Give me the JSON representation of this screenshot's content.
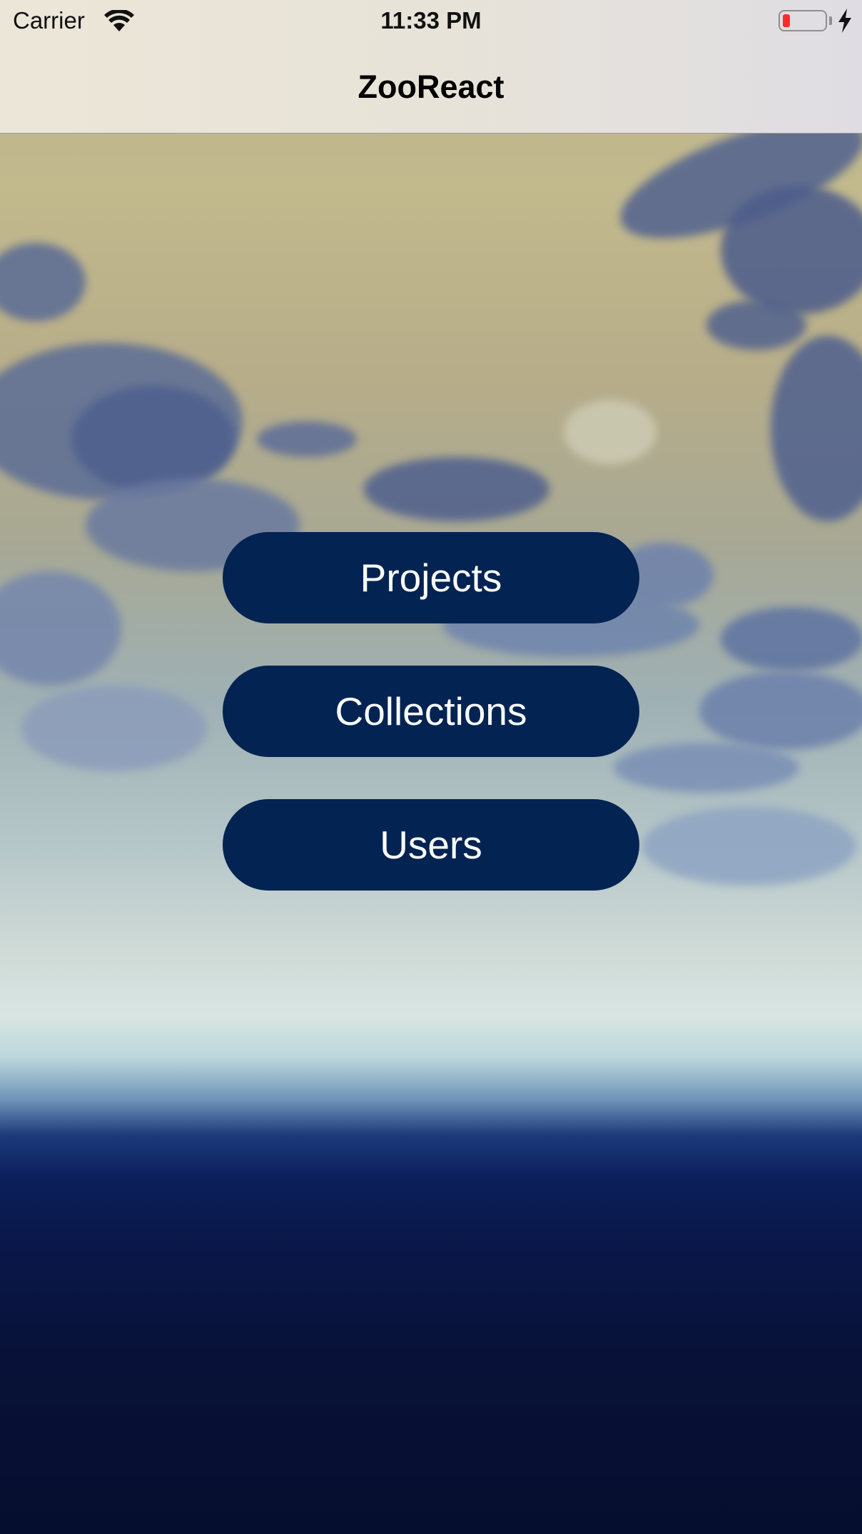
{
  "status_bar": {
    "carrier": "Carrier",
    "time": "11:33 PM",
    "wifi_icon": "wifi-icon",
    "battery_icon": "battery-low-icon",
    "charging_icon": "charging-bolt-icon",
    "battery_color": "#ff2b2b"
  },
  "nav": {
    "title": "ZooReact"
  },
  "menu": {
    "items": [
      {
        "label": "Projects"
      },
      {
        "label": "Collections"
      },
      {
        "label": "Users"
      }
    ],
    "button_color": "#032452",
    "text_color": "#ffffff"
  }
}
